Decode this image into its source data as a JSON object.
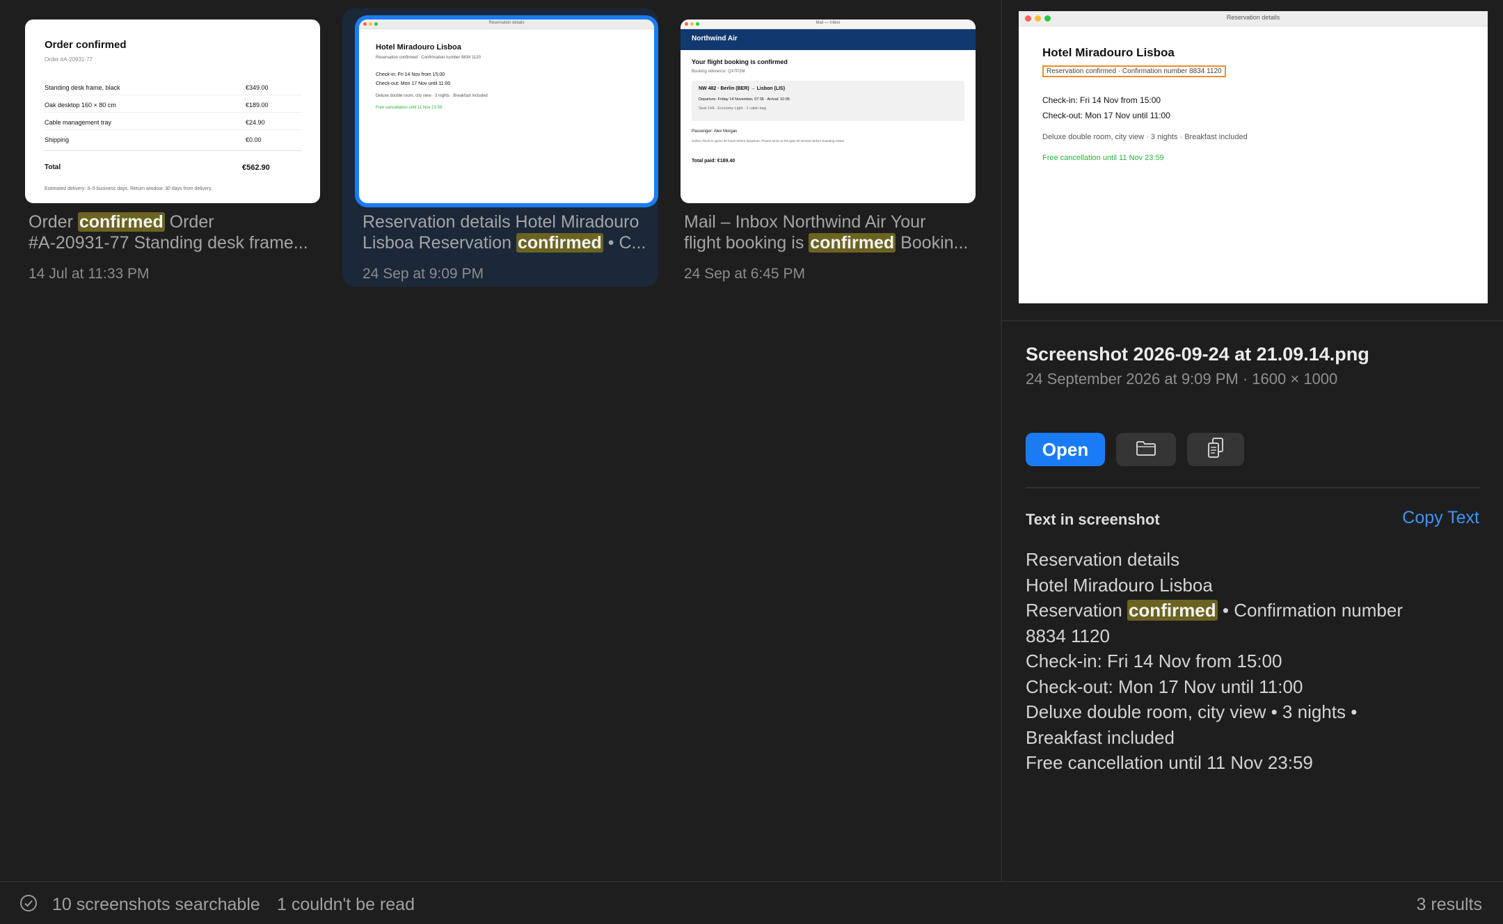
{
  "results": [
    {
      "caption_before": "Order ",
      "caption_highlight": "confirmed",
      "caption_after": " Order",
      "caption_line2": "#A-20931-77 Standing desk frame...",
      "date": "14 Jul at 11:33 PM",
      "thumb": {
        "title": "Order confirmed",
        "subtitle": "Order #A-20931-77",
        "items": [
          {
            "name": "Standing desk frame, black",
            "price": "€349.00"
          },
          {
            "name": "Oak desktop 160 × 80 cm",
            "price": "€189.00"
          },
          {
            "name": "Cable management tray",
            "price": "€24.90"
          },
          {
            "name": "Shipping",
            "price": "€0.00"
          }
        ],
        "total_label": "Total",
        "total_value": "€562.90",
        "footer": "Estimated delivery: 3–5 business days. Return window: 30 days from delivery."
      }
    },
    {
      "caption_line1": "Reservation details Hotel Miradouro",
      "caption_before": "Lisboa Reservation ",
      "caption_highlight": "confirmed",
      "caption_after": " • C...",
      "date": "24 Sep at 9:09 PM",
      "thumb": {
        "window_title": "Reservation details",
        "heading": "Hotel Miradouro Lisboa",
        "confirm": "Reservation confirmed · Confirmation number 8834 1120",
        "checkin": "Check-in: Fri 14 Nov from 15:00",
        "checkout": "Check-out: Mon 17 Nov until 11:00",
        "room": "Deluxe double room, city view · 3 nights · Breakfast included",
        "cancel": "Free cancellation until 11 Nov 23:59"
      }
    },
    {
      "caption_line1": "Mail – Inbox Northwind Air Your",
      "caption_before": "flight booking is ",
      "caption_highlight": "confirmed",
      "caption_after": " Bookin...",
      "date": "24 Sep at 6:45 PM",
      "thumb": {
        "window_title": "Mail — Inbox",
        "brand": "Northwind Air",
        "heading": "Your flight booking is confirmed",
        "ref": "Booking reference: QX7P2M",
        "flight": "NW 482 · Berlin (BER) → Lisbon (LIS)",
        "times": "Departure: Friday 14 November, 07:35 · Arrival: 10:05",
        "seat": "Seat 14A · Economy Light · 1 cabin bag",
        "passenger": "Passenger: Alex Morgan",
        "note": "Online check-in opens 30 hours before departure. Please arrive at the gate 30 minutes before boarding closes.",
        "paid": "Total paid: €189.40"
      }
    }
  ],
  "panel": {
    "preview": {
      "window_title": "Reservation details",
      "heading": "Hotel Miradouro Lisboa",
      "confirm": "Reservation confirmed · Confirmation number 8834 1120",
      "checkin": "Check-in: Fri 14 Nov from 15:00",
      "checkout": "Check-out: Mon 17 Nov until 11:00",
      "room": "Deluxe double room, city view · 3 nights · Breakfast included",
      "cancel": "Free cancellation until 11 Nov 23:59"
    },
    "file_name": "Screenshot 2026-09-24 at 21.09.14.png",
    "file_meta": "24 September 2026 at 9:09 PM · 1600 × 1000",
    "open_label": "Open",
    "text_section_label": "Text in screenshot",
    "copy_text_label": "Copy Text",
    "ocr": {
      "l1": "Reservation details",
      "l2": "Hotel Miradouro Lisboa",
      "l3_before": "Reservation ",
      "l3_highlight": "confirmed",
      "l3_after": " • Confirmation number",
      "l4": "8834 1120",
      "l5": "Check-in: Fri 14 Nov from 15:00",
      "l6": "Check-out: Mon 17 Nov until 11:00",
      "l7": "Deluxe double room, city view • 3 nights •",
      "l8": "Breakfast included",
      "l9": "Free cancellation until 11 Nov 23:59"
    }
  },
  "status": {
    "searchable": "10 screenshots searchable",
    "unreadable": "1 couldn't be read",
    "results": "3 results"
  },
  "colors": {
    "accent": "#1a7cf5",
    "highlight": "#6b6321",
    "link": "#3d94f6",
    "ocr_box": "#f08c2b",
    "green_text": "#28b33e"
  }
}
